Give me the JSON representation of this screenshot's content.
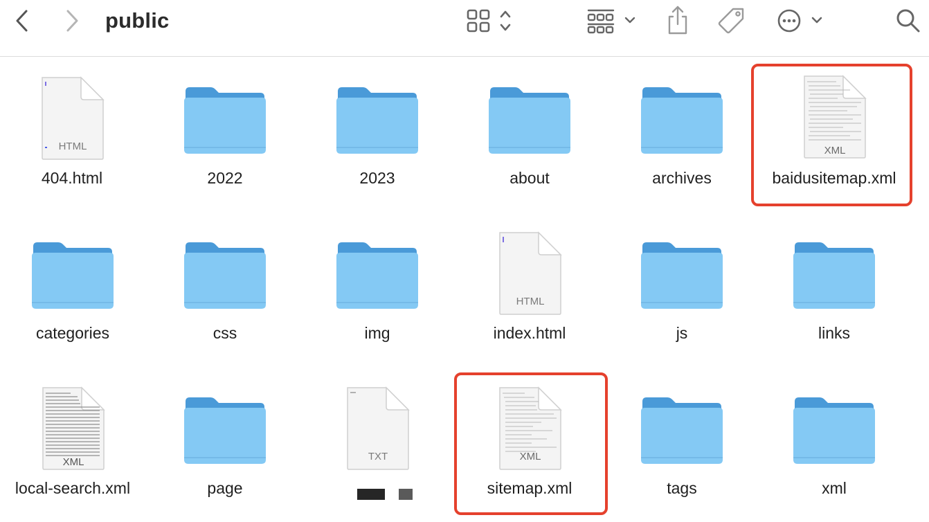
{
  "toolbar": {
    "title": "public",
    "buttons": {
      "back": "chevron-left-icon",
      "forward": "chevron-right-icon",
      "view": "icon-grid-icon",
      "group": "group-by-icon",
      "share": "share-icon",
      "tag": "tag-icon",
      "more": "ellipsis-circle-icon",
      "search": "search-icon"
    }
  },
  "files": [
    {
      "name": "404.html",
      "kind": "file",
      "badge": "HTML"
    },
    {
      "name": "2022",
      "kind": "folder"
    },
    {
      "name": "2023",
      "kind": "folder"
    },
    {
      "name": "about",
      "kind": "folder"
    },
    {
      "name": "archives",
      "kind": "folder"
    },
    {
      "name": "baidusitemap.xml",
      "kind": "file",
      "badge": "XML",
      "highlighted": true
    },
    {
      "name": "categories",
      "kind": "folder"
    },
    {
      "name": "css",
      "kind": "folder"
    },
    {
      "name": "img",
      "kind": "folder"
    },
    {
      "name": "index.html",
      "kind": "file",
      "badge": "HTML"
    },
    {
      "name": "js",
      "kind": "folder"
    },
    {
      "name": "links",
      "kind": "folder"
    },
    {
      "name": "local-search.xml",
      "kind": "file",
      "badge": "XML"
    },
    {
      "name": "page",
      "kind": "folder"
    },
    {
      "name": "",
      "kind": "file",
      "badge": "TXT",
      "redacted_name": true
    },
    {
      "name": "sitemap.xml",
      "kind": "file",
      "badge": "XML",
      "highlighted": true
    },
    {
      "name": "tags",
      "kind": "folder"
    },
    {
      "name": "xml",
      "kind": "folder"
    }
  ],
  "colors": {
    "folder_back": "#4a9ad8",
    "folder_front": "#84c9f4",
    "highlight": "#e5412d",
    "toolbar_icon": "#6f6f6f"
  }
}
